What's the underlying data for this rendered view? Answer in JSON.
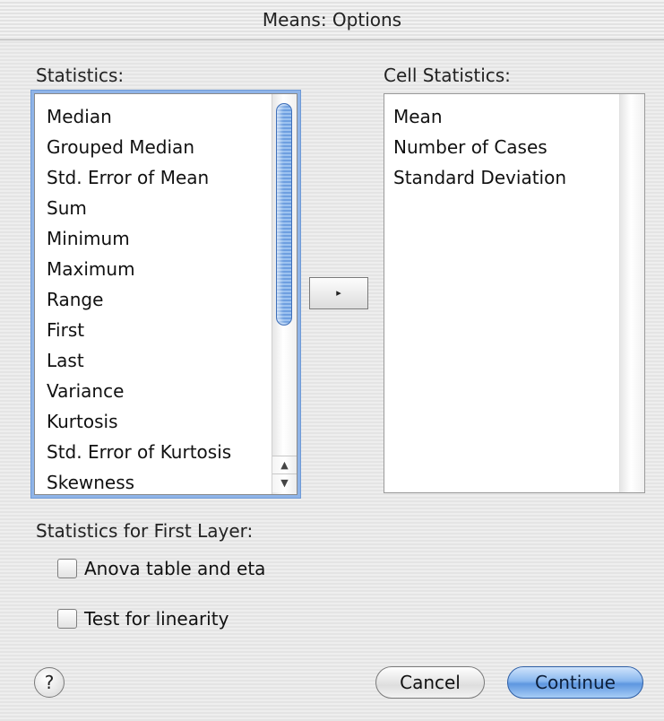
{
  "window": {
    "title": "Means: Options"
  },
  "statistics": {
    "label": "Statistics:",
    "items": [
      "Median",
      "Grouped Median",
      "Std. Error of Mean",
      "Sum",
      "Minimum",
      "Maximum",
      "Range",
      "First",
      "Last",
      "Variance",
      "Kurtosis",
      "Std. Error of Kurtosis",
      "Skewness"
    ]
  },
  "cell_statistics": {
    "label": "Cell Statistics:",
    "items": [
      "Mean",
      "Number of Cases",
      "Standard Deviation"
    ]
  },
  "move_button": {
    "icon": "right-triangle-icon",
    "glyph": "▸"
  },
  "first_layer": {
    "label": "Statistics for First Layer:",
    "anova_label": "Anova table and eta",
    "linearity_label": "Test for linearity"
  },
  "scroll_arrows": {
    "up": "▲",
    "down": "▼"
  },
  "buttons": {
    "help": "?",
    "cancel": "Cancel",
    "continue": "Continue"
  },
  "colors": {
    "accent": "#6e9fe0",
    "focus_ring": "#8fb4e8"
  }
}
